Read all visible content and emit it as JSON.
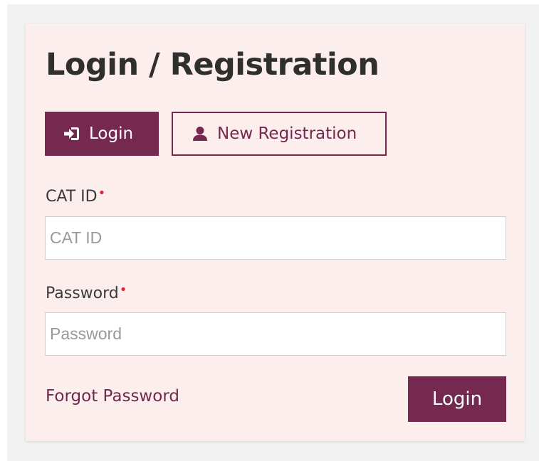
{
  "form": {
    "title": "Login / Registration",
    "tabs": {
      "login": {
        "label": "Login",
        "icon": "sign-in-icon",
        "active": true
      },
      "register": {
        "label": "New Registration",
        "icon": "user-icon",
        "active": false
      }
    },
    "catid": {
      "label": "CAT ID",
      "required_marker": "•",
      "placeholder": "CAT ID",
      "value": ""
    },
    "password": {
      "label": "Password",
      "required_marker": "•",
      "placeholder": "Password",
      "value": ""
    },
    "forgot_label": "Forgot Password",
    "submit_label": "Login"
  },
  "colors": {
    "accent": "#75294f",
    "card_background": "#fdeeee",
    "required": "#e0242f"
  }
}
